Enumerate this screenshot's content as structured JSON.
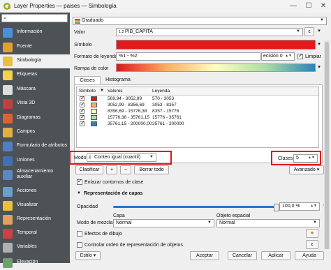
{
  "window": {
    "title": "Layer Properties — paises — Simbología"
  },
  "sidebar": {
    "search_placeholder": "",
    "items": [
      {
        "label": "Información",
        "color": "#4a90d9"
      },
      {
        "label": "Fuente",
        "color": "#e0a030"
      },
      {
        "label": "Simbología",
        "color": "#e8c040"
      },
      {
        "label": "Etiquetas",
        "color": "#f2d24a"
      },
      {
        "label": "Máscara",
        "color": "#dddddd"
      },
      {
        "label": "Vista 3D",
        "color": "#c04040"
      },
      {
        "label": "Diagramas",
        "color": "#e06030"
      },
      {
        "label": "Campos",
        "color": "#e0b040"
      },
      {
        "label": "Formulario de atributos",
        "color": "#5080c0"
      },
      {
        "label": "Uniones",
        "color": "#4070b0"
      },
      {
        "label": "Almacenamiento auxiliar",
        "color": "#5a88c0"
      },
      {
        "label": "Acciones",
        "color": "#6aa0d0"
      },
      {
        "label": "Visualizar",
        "color": "#e8c040"
      },
      {
        "label": "Representación",
        "color": "#e0a060"
      },
      {
        "label": "Temporal",
        "color": "#d04040"
      },
      {
        "label": "Variables",
        "color": "#b0b0b0"
      },
      {
        "label": "Elevación",
        "color": "#70a070"
      }
    ]
  },
  "renderer": {
    "type": "Graduado"
  },
  "form": {
    "valor_label": "Valor",
    "valor_value": "PIB_CAPITA",
    "valor_prefix": "1.2",
    "simbolo_label": "Símbolo",
    "formato_label": "Formato de leyenda",
    "formato_value": "%1 - %2",
    "precision_label": "ecisión 0",
    "limpiar_label": "Limpiar",
    "rampa_label": "Rampa de color"
  },
  "tabs": {
    "clases": "Clases",
    "histograma": "Histograma"
  },
  "table": {
    "headers": [
      "Símbolo",
      "Valores",
      "Leyenda"
    ],
    "rows": [
      {
        "color": "#d7191c",
        "values": "569,94 - 3052,99",
        "legend": "570 - 3053"
      },
      {
        "color": "#fdae61",
        "values": "3052,99 - 8356,69",
        "legend": "3053 - 8357"
      },
      {
        "color": "#ffffbf",
        "values": "8356,69 - 15776,38",
        "legend": "8357 - 15776"
      },
      {
        "color": "#abdda4",
        "values": "15776,38 - 35761,15",
        "legend": "15776 - 35761"
      },
      {
        "color": "#2b83ba",
        "values": "35761,15 - 200000,00",
        "legend": "35761 - 200000"
      }
    ]
  },
  "mode": {
    "label": "Modo",
    "value": "Conteo igual (cuantil)"
  },
  "classes": {
    "label": "Clases",
    "value": "5"
  },
  "buttons": {
    "clasificar": "Clasificar",
    "borrar_todo": "Borrar todo",
    "avanzado": "Avanzado",
    "aceptar": "Aceptar",
    "cancelar": "Cancelar",
    "aplicar": "Aplicar",
    "ayuda": "Ayuda",
    "estilo": "Estilo"
  },
  "options": {
    "enlazar": "Enlazar contornos de clase"
  },
  "layer_render": {
    "title": "Representación de capas",
    "opacidad_label": "Opacidad",
    "opacidad_value": "100,0 %",
    "capa_label": "Capa",
    "objeto_label": "Objeto espacial",
    "modo_mezcla_label": "Modo de mezcla",
    "capa_value": "Normal",
    "objeto_value": "Normal",
    "efectos_label": "Efectos de dibujo",
    "controlar_label": "Controlar orden de representación de objetos"
  },
  "colors": {
    "accent_red": "#e0141b",
    "symbol_red": "#e31a1c"
  }
}
